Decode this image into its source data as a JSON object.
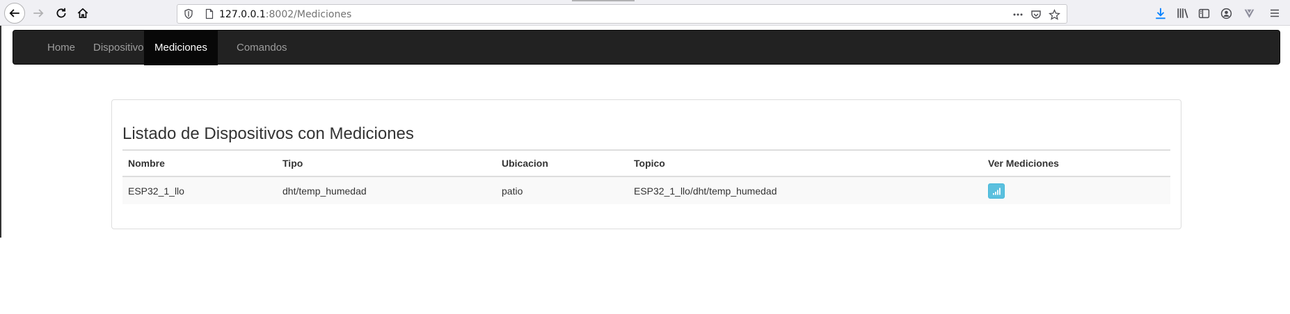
{
  "browser": {
    "url_host": "127.0.0.1",
    "url_rest": ":8002/Mediciones",
    "icons": [
      "back-icon",
      "forward-icon",
      "reload-icon",
      "home-icon",
      "shield-icon",
      "page-icon",
      "more-icon",
      "pocket-icon",
      "star-icon",
      "download-icon",
      "library-icon",
      "sidebar-icon",
      "account-icon",
      "extension-icon",
      "menu-icon"
    ],
    "accent_color": "#0a84ff"
  },
  "navbar": {
    "items": [
      {
        "label": "Home",
        "active": false
      },
      {
        "label": "Dispositivos",
        "active": false
      },
      {
        "label": "Mediciones",
        "active": true
      },
      {
        "label": "Comandos",
        "active": false
      }
    ],
    "background": "#222222"
  },
  "panel": {
    "title": "Listado de Dispositivos con Mediciones",
    "table": {
      "headers": [
        "Nombre",
        "Tipo",
        "Ubicacion",
        "Topico",
        "Ver Mediciones"
      ],
      "rows": [
        {
          "nombre": "ESP32_1_llo",
          "tipo": "dht/temp_humedad",
          "ubicacion": "patio",
          "topico": "ESP32_1_llo/dht/temp_humedad",
          "action_icon": "signal-bars-icon"
        }
      ]
    },
    "button_color": "#5bc0de"
  }
}
